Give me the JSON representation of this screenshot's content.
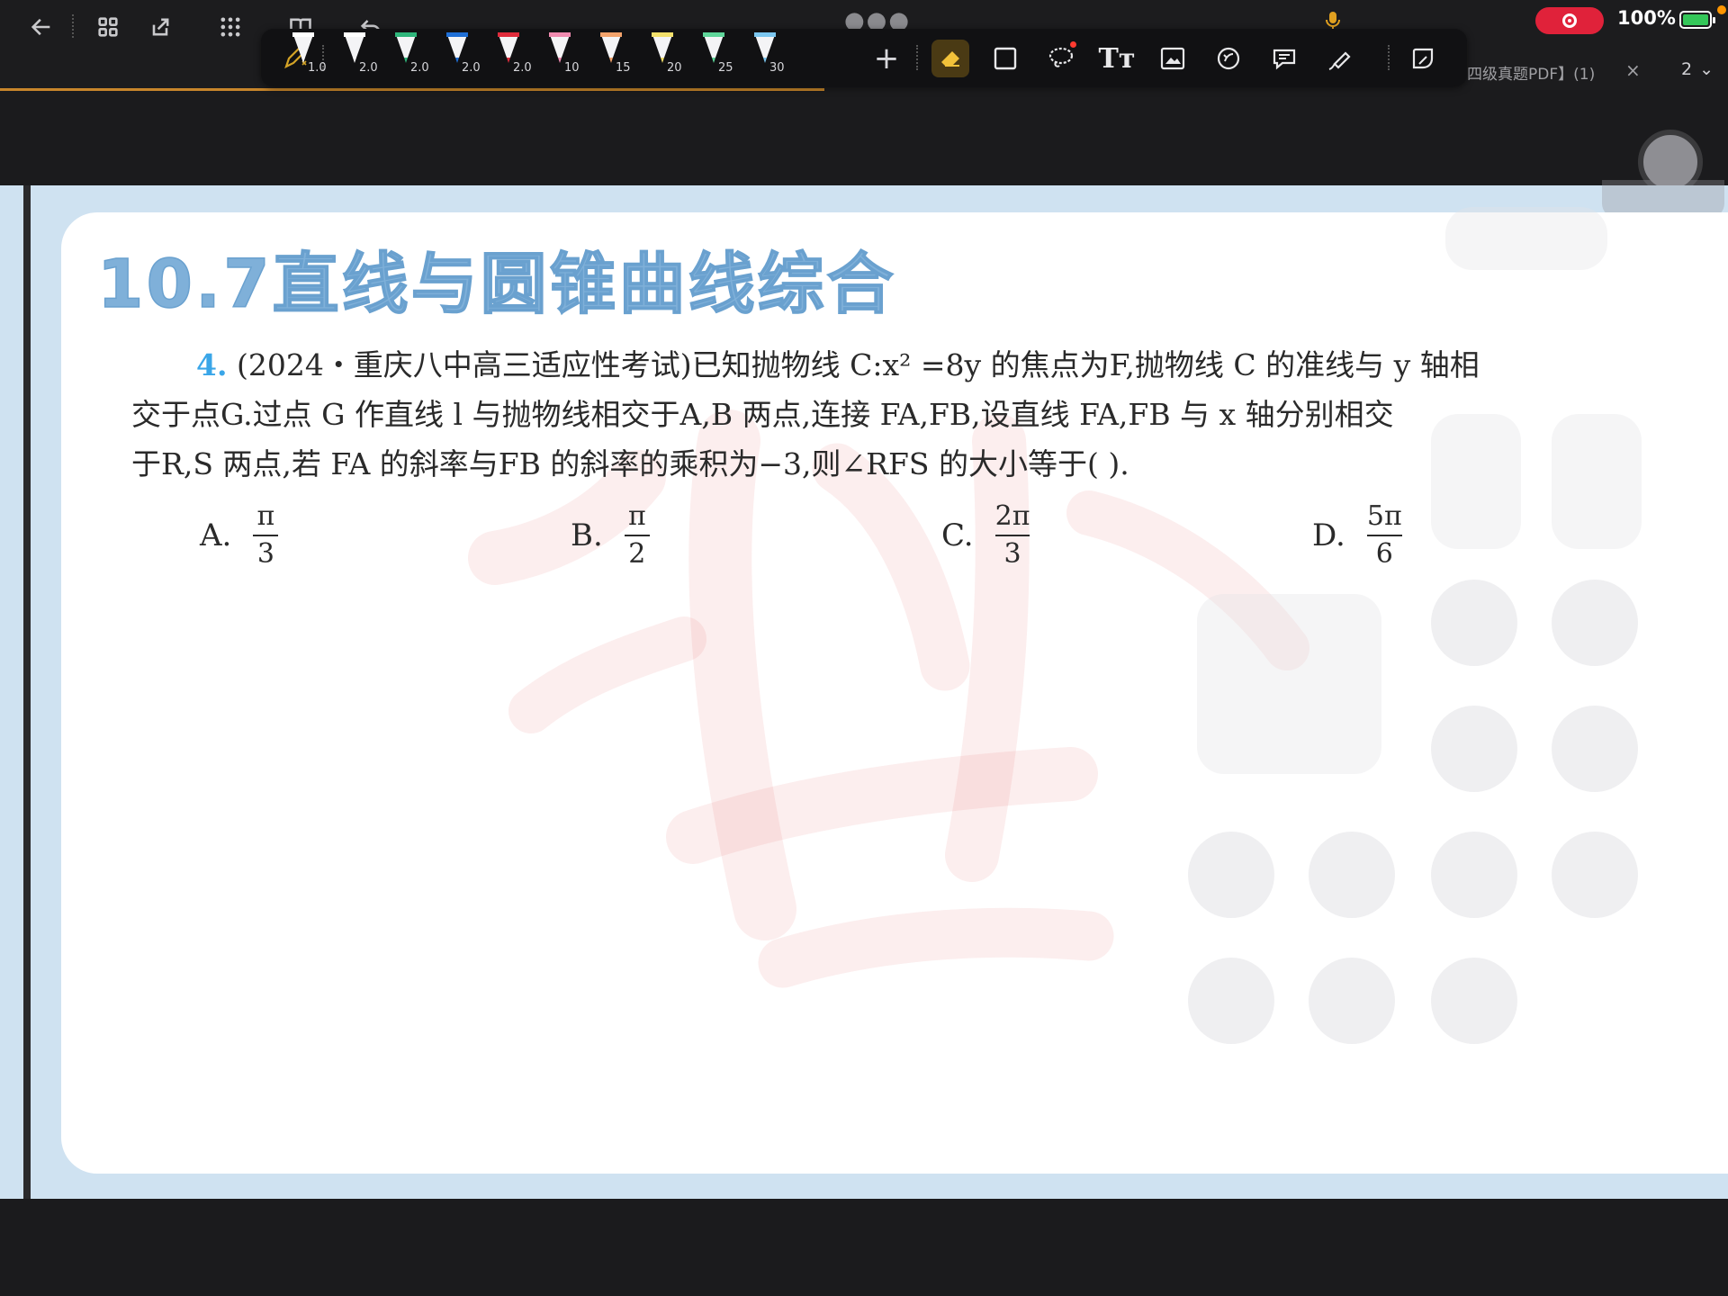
{
  "status": {
    "battery_percent": "100%"
  },
  "tab": {
    "title": "四级真题PDF】(1)",
    "close_glyph": "×"
  },
  "page_selector": {
    "value": "2",
    "chevron": "⌄"
  },
  "pen_toolbar": {
    "pens": [
      {
        "size": "1.0",
        "color": "#ffffff"
      },
      {
        "size": "2.0",
        "color": "#ffffff"
      },
      {
        "size": "2.0",
        "color": "#2fb67b"
      },
      {
        "size": "2.0",
        "color": "#1f6fd6"
      },
      {
        "size": "2.0",
        "color": "#e02c3c"
      },
      {
        "size": "10",
        "color": "#f08bb0"
      },
      {
        "size": "15",
        "color": "#f3a36b"
      },
      {
        "size": "20",
        "color": "#f3e06b"
      },
      {
        "size": "25",
        "color": "#5fd69a"
      },
      {
        "size": "30",
        "color": "#7cc7f0"
      }
    ],
    "add_glyph": "+",
    "text_tool_glyph": "Tт"
  },
  "document": {
    "section_title": "10.7直线与圆锥曲线综合",
    "question": {
      "number": "4.",
      "line1": "(2024・重庆八中高三适应性考试)已知抛物线 C:x² =8y 的焦点为F,抛物线 C 的准线与 y 轴相",
      "line2": "交于点G.过点 G 作直线 l 与抛物线相交于A,B 两点,连接 FA,FB,设直线 FA,FB 与 x 轴分别相交",
      "line3": "于R,S 两点,若 FA 的斜率与FB 的斜率的乘积为−3,则∠RFS 的大小等于(      )."
    },
    "options": [
      {
        "label": "A.",
        "num": "π",
        "den": "3"
      },
      {
        "label": "B.",
        "num": "π",
        "den": "2"
      },
      {
        "label": "C.",
        "num": "2π",
        "den": "3"
      },
      {
        "label": "D.",
        "num": "5π",
        "den": "6"
      }
    ]
  },
  "colors": {
    "accent_progress": "#c8862b",
    "title_blue": "#7fb0d9",
    "question_number": "#3aa6e8",
    "record_red": "#e0223a"
  }
}
